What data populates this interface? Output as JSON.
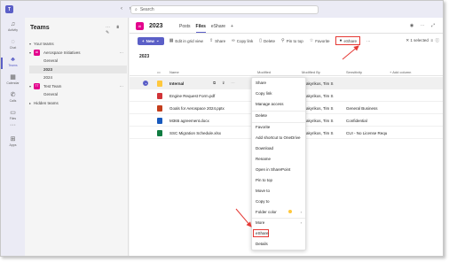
{
  "search": {
    "placeholder": "Search"
  },
  "rail": [
    {
      "label": "Activity"
    },
    {
      "label": "Chat"
    },
    {
      "label": "Teams"
    },
    {
      "label": "Calendar"
    },
    {
      "label": "Calls"
    },
    {
      "label": "Files"
    },
    {
      "label": "Apps"
    }
  ],
  "panel": {
    "title": "Teams",
    "section_your_teams": "Your teams",
    "section_hidden": "Hidden teams",
    "teams": [
      {
        "initials": "AI",
        "name": "Aerospace Initiatives",
        "color": "#e3008c",
        "channels": [
          "General",
          "2023",
          "2024"
        ]
      },
      {
        "initials": "TT",
        "name": "Test Team",
        "color": "#e3008c",
        "channels": [
          "General"
        ]
      }
    ]
  },
  "header": {
    "tile": "AI",
    "title": "2023",
    "tabs": [
      "Posts",
      "Files",
      "eShare"
    ],
    "active_tab": "Files"
  },
  "toolbar": {
    "new": "New",
    "edit_grid": "Edit in grid view",
    "share": "Share",
    "copy_link": "Copy link",
    "delete": "Delete",
    "pin_to_top": "Pin to top",
    "favorite": "Favorite",
    "eshare": "eShare",
    "more": "···",
    "selected": "1 selected"
  },
  "breadcrumb": "2023",
  "columns": {
    "name": "Name",
    "modified": "Modified",
    "modified_by": "Modified By",
    "sensitivity": "Sensitivity",
    "add_column": "+ Add column"
  },
  "rows": [
    {
      "name": "Internal",
      "type": "folder",
      "modified_by": "Tim S",
      "sensitivity": "",
      "color": "#ffc83d"
    },
    {
      "name": "Engine Request Form.pdf",
      "type": "pdf",
      "modified_by": "Tim S",
      "sensitivity": "",
      "color": "#d13438"
    },
    {
      "name": "Goals for Aerospace 2024.pptx",
      "type": "pptx",
      "modified_by": "Tim S",
      "sensitivity": "General Business",
      "color": "#c43e1c"
    },
    {
      "name": "M365 agreement.docx",
      "type": "docx",
      "modified_by": "Tim S",
      "sensitivity": "Confidential",
      "color": "#185abd"
    },
    {
      "name": "SSC Migration Schedule.xlsx",
      "type": "xlsx",
      "modified_by": "Tim S",
      "sensitivity": "CUI - No License Requ",
      "color": "#107c41"
    }
  ],
  "modified_by_prefix": "apakyrikos, ",
  "menu": {
    "items": [
      "Share",
      "Copy link",
      "Manage access",
      "Delete",
      "Favorite",
      "Add shortcut to OneDrive",
      "Download",
      "Rename",
      "Open in SharePoint",
      "Pin to top",
      "Move to",
      "Copy to",
      "Folder color",
      "More",
      "eShare",
      "Details"
    ]
  },
  "colors": {
    "accent": "#5b5fc7",
    "highlight": "#e53935",
    "team": "#e3008c"
  }
}
